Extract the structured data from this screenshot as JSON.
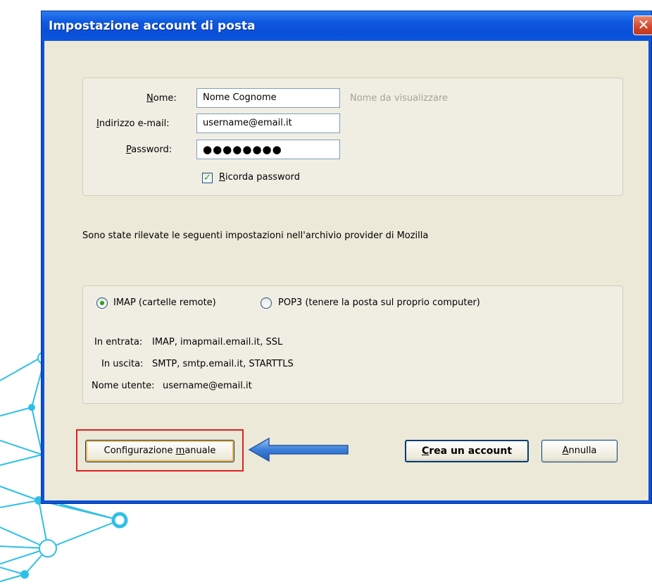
{
  "window": {
    "title": "Impostazione account di posta",
    "close_label": "✕"
  },
  "account": {
    "name_label": "Nome:",
    "name_value": "Nome Cognome",
    "name_hint": "Nome da visualizzare",
    "email_label": "Indirizzo e-mail:",
    "email_value": "username@email.it",
    "password_label": "Password:",
    "password_value": "●●●●●●●●",
    "remember_label": "Ricorda password",
    "remember_checked": true
  },
  "detected_message": "Sono state rilevate le seguenti impostazioni nell'archivio provider di Mozilla",
  "protocol": {
    "imap_label": "IMAP (cartelle remote)",
    "pop3_label": "POP3 (tenere la posta sul proprio computer)",
    "selected": "IMAP"
  },
  "server_settings": {
    "incoming_label": "In entrata:",
    "incoming_value": "IMAP, imapmail.email.it, SSL",
    "outgoing_label": "In uscita:",
    "outgoing_value": "SMTP, smtp.email.it, STARTTLS",
    "username_label": "Nome utente:",
    "username_value": "username@email.it"
  },
  "buttons": {
    "manual_config": "Configurazione manuale",
    "create_account": "Crea un account",
    "cancel": "Annulla"
  },
  "colors": {
    "titlebar": "#0a52d6",
    "dialog_bg": "#ece9d8",
    "highlight": "#e02020",
    "arrow": "#3a7fd8",
    "network": "#2fc0e6"
  }
}
